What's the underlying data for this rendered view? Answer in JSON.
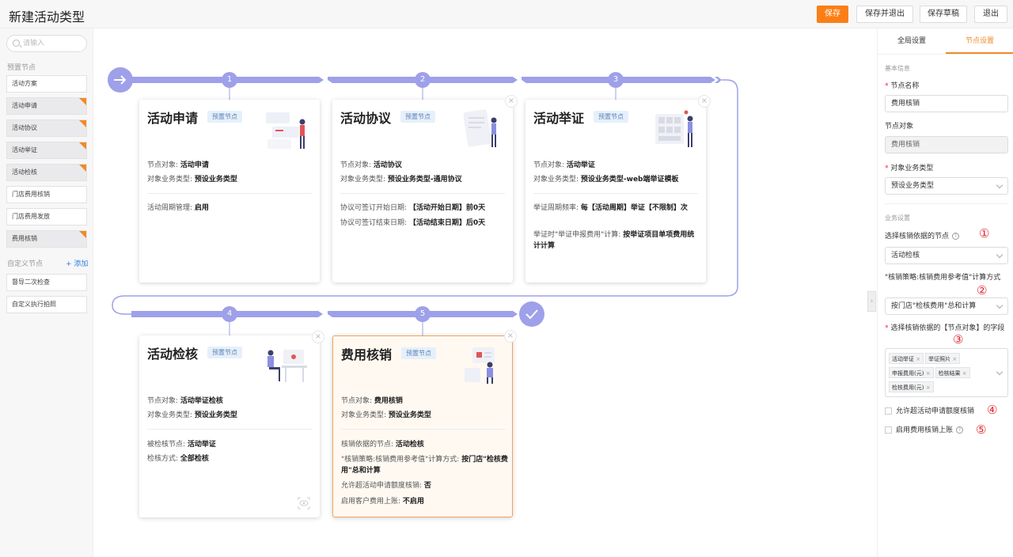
{
  "header": {
    "title": "新建活动类型",
    "save": "保存",
    "save_exit": "保存并退出",
    "save_draft": "保存草稿",
    "exit": "退出"
  },
  "left": {
    "search_placeholder": "请输入",
    "preset_title": "预置节点",
    "preset_items": [
      {
        "label": "活动方案",
        "used": false
      },
      {
        "label": "活动申请",
        "used": true
      },
      {
        "label": "活动协议",
        "used": true
      },
      {
        "label": "活动举证",
        "used": true
      },
      {
        "label": "活动检核",
        "used": true
      },
      {
        "label": "门店费用核销",
        "used": false
      },
      {
        "label": "门店费用发放",
        "used": false
      },
      {
        "label": "费用核销",
        "used": true
      }
    ],
    "custom_title": "自定义节点",
    "add_label": "+ 添加",
    "custom_items": [
      {
        "label": "督导二次检查"
      },
      {
        "label": "自定义执行拍照"
      }
    ]
  },
  "flow": {
    "steps": [
      "1",
      "2",
      "3",
      "4",
      "5"
    ],
    "cards": [
      {
        "title": "活动申请",
        "tag": "预置节点",
        "lines": [
          [
            "节点对象: ",
            "活动申请"
          ],
          [
            "对象业务类型: ",
            "预设业务类型"
          ]
        ],
        "lines2": [
          [
            "活动周期管理: ",
            "启用"
          ]
        ]
      },
      {
        "title": "活动协议",
        "tag": "预置节点",
        "lines": [
          [
            "节点对象: ",
            "活动协议"
          ],
          [
            "对象业务类型: ",
            "预设业务类型-通用协议"
          ]
        ],
        "lines2": [
          [
            "协议可签订开始日期: ",
            "【活动开始日期】前0天"
          ],
          [
            "协议可签订结束日期: ",
            "【活动结束日期】后0天"
          ]
        ]
      },
      {
        "title": "活动举证",
        "tag": "预置节点",
        "lines": [
          [
            "节点对象: ",
            "活动举证"
          ],
          [
            "对象业务类型: ",
            "预设业务类型-web端举证模板"
          ]
        ],
        "lines2": [
          [
            "举证周期频率: ",
            "每【活动周期】举证【不限制】次"
          ],
          [
            "举证时\"举证申报费用\"计算: ",
            "按举证项目单项费用统计计算"
          ]
        ]
      },
      {
        "title": "活动检核",
        "tag": "预置节点",
        "lines": [
          [
            "节点对象: ",
            "活动举证检核"
          ],
          [
            "对象业务类型: ",
            "预设业务类型"
          ]
        ],
        "lines2": [
          [
            "被检核节点: ",
            "活动举证"
          ],
          [
            "检核方式: ",
            "全部检核"
          ]
        ]
      },
      {
        "title": "费用核销",
        "tag": "预置节点",
        "lines": [
          [
            "节点对象: ",
            "费用核销"
          ],
          [
            "对象业务类型: ",
            "预设业务类型"
          ]
        ],
        "lines2": [
          [
            "核销依据的节点: ",
            "活动检核"
          ],
          [
            "\"核销策略:核销费用参考值\"计算方式: ",
            "按门店\"检核费用\"总和计算"
          ],
          [
            "允许超活动申请额度核销: ",
            "否"
          ],
          [
            "启用客户费用上账: ",
            "不启用"
          ]
        ]
      }
    ]
  },
  "right": {
    "tabs": [
      "全局设置",
      "节点设置"
    ],
    "basic_title": "基本信息",
    "name_label": "节点名称",
    "name_value": "费用核销",
    "object_label": "节点对象",
    "object_value": "费用核销",
    "biz_label": "对象业务类型",
    "biz_value": "预设业务类型",
    "biz_settings_title": "业务设置",
    "q1_label": "选择核销依据的节点",
    "q1_value": "活动检核",
    "q2_label": "\"核销策略:核销费用参考值\"计算方式",
    "q2_value": "按门店\"检核费用\"总和计算",
    "q3_label": "选择核销依据的【节点对象】的字段",
    "q3_chips": [
      "活动举证",
      "举证照片",
      "申报费用(元)",
      "检核结果",
      "检核费用(元)"
    ],
    "cb1": "允许超活动申请额度核销",
    "cb2": "启用费用核销上账",
    "markers": [
      "①",
      "②",
      "③",
      "④",
      "⑤"
    ]
  },
  "colors": {
    "accent": "#fb7f16",
    "flow": "#9ea0e9"
  }
}
